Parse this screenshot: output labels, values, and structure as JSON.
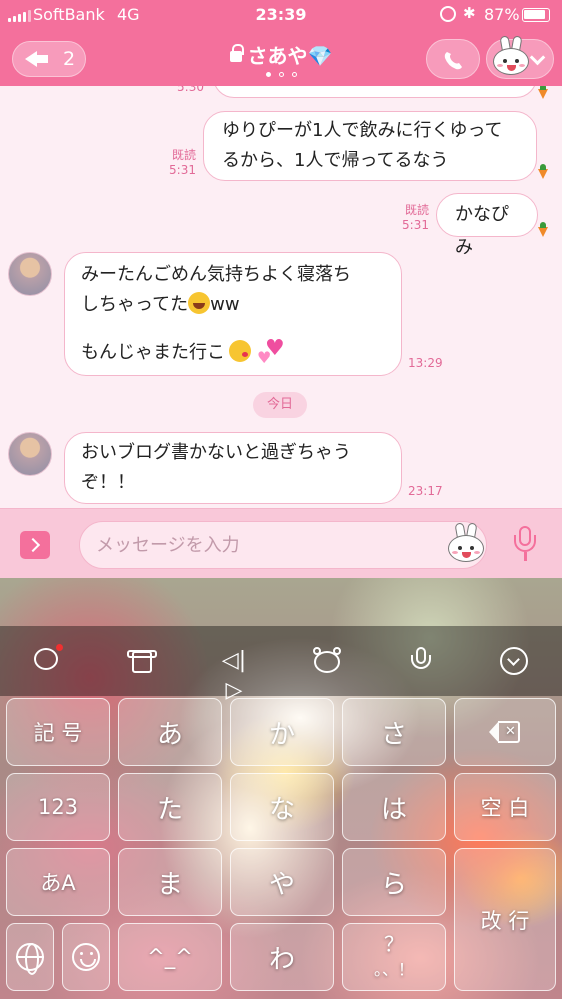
{
  "status": {
    "carrier": "SoftBank",
    "network": "4G",
    "time": "23:39",
    "battery": "87%",
    "battery_level": 0.87
  },
  "header": {
    "back_count": "2",
    "title": "さあや💎",
    "page_dots": 3,
    "active_dot": 0
  },
  "chat": {
    "cut_timestamp": "5:30",
    "messages": [
      {
        "side": "right",
        "text": "ゆりぴーが1人で飲みに行くゆってるから、1人で帰ってるなう",
        "line1": "ゆりぴーが1人で飲みに行くゆって",
        "line2": "るから、1人で帰ってるなう",
        "read": "既読",
        "time": "5:31"
      },
      {
        "side": "right",
        "text": "かなぴみ",
        "read": "既読",
        "time": "5:31"
      },
      {
        "side": "left",
        "line1": "みーたんごめん気持ちよく寝落ち",
        "line2a": "しちゃってた",
        "line2b": "ww",
        "line3": "もんじゃまた行こ",
        "time": "13:29"
      },
      {
        "side": "left",
        "line1": "おいブログ書かないと過ぎちゃう",
        "line2": "ぞ！！",
        "time": "23:17"
      }
    ],
    "date_separator": "今日"
  },
  "input": {
    "placeholder": "メッセージを入力"
  },
  "keyboard": {
    "toolbar_icons": [
      "chat-bubble-icon",
      "shirt-icon",
      "cursor-move-icon",
      "bear-face-icon",
      "microphone-icon",
      "hide-keyboard-icon"
    ],
    "keys": {
      "symbols": "記 号",
      "a": "あ",
      "ka": "か",
      "sa": "さ",
      "num": "123",
      "ta": "た",
      "na": "な",
      "ha": "は",
      "space": "空 白",
      "kana_mode": "あA",
      "ma": "ま",
      "ya": "や",
      "ra": "ら",
      "enter": "改 行",
      "face": "^_^",
      "wa": "わ",
      "punct_top": "？",
      "punct_bottom": "。、！"
    }
  },
  "colors": {
    "accent": "#f4709c",
    "chat_bg": "#fdeef4",
    "timestamp": "#e26a97"
  }
}
